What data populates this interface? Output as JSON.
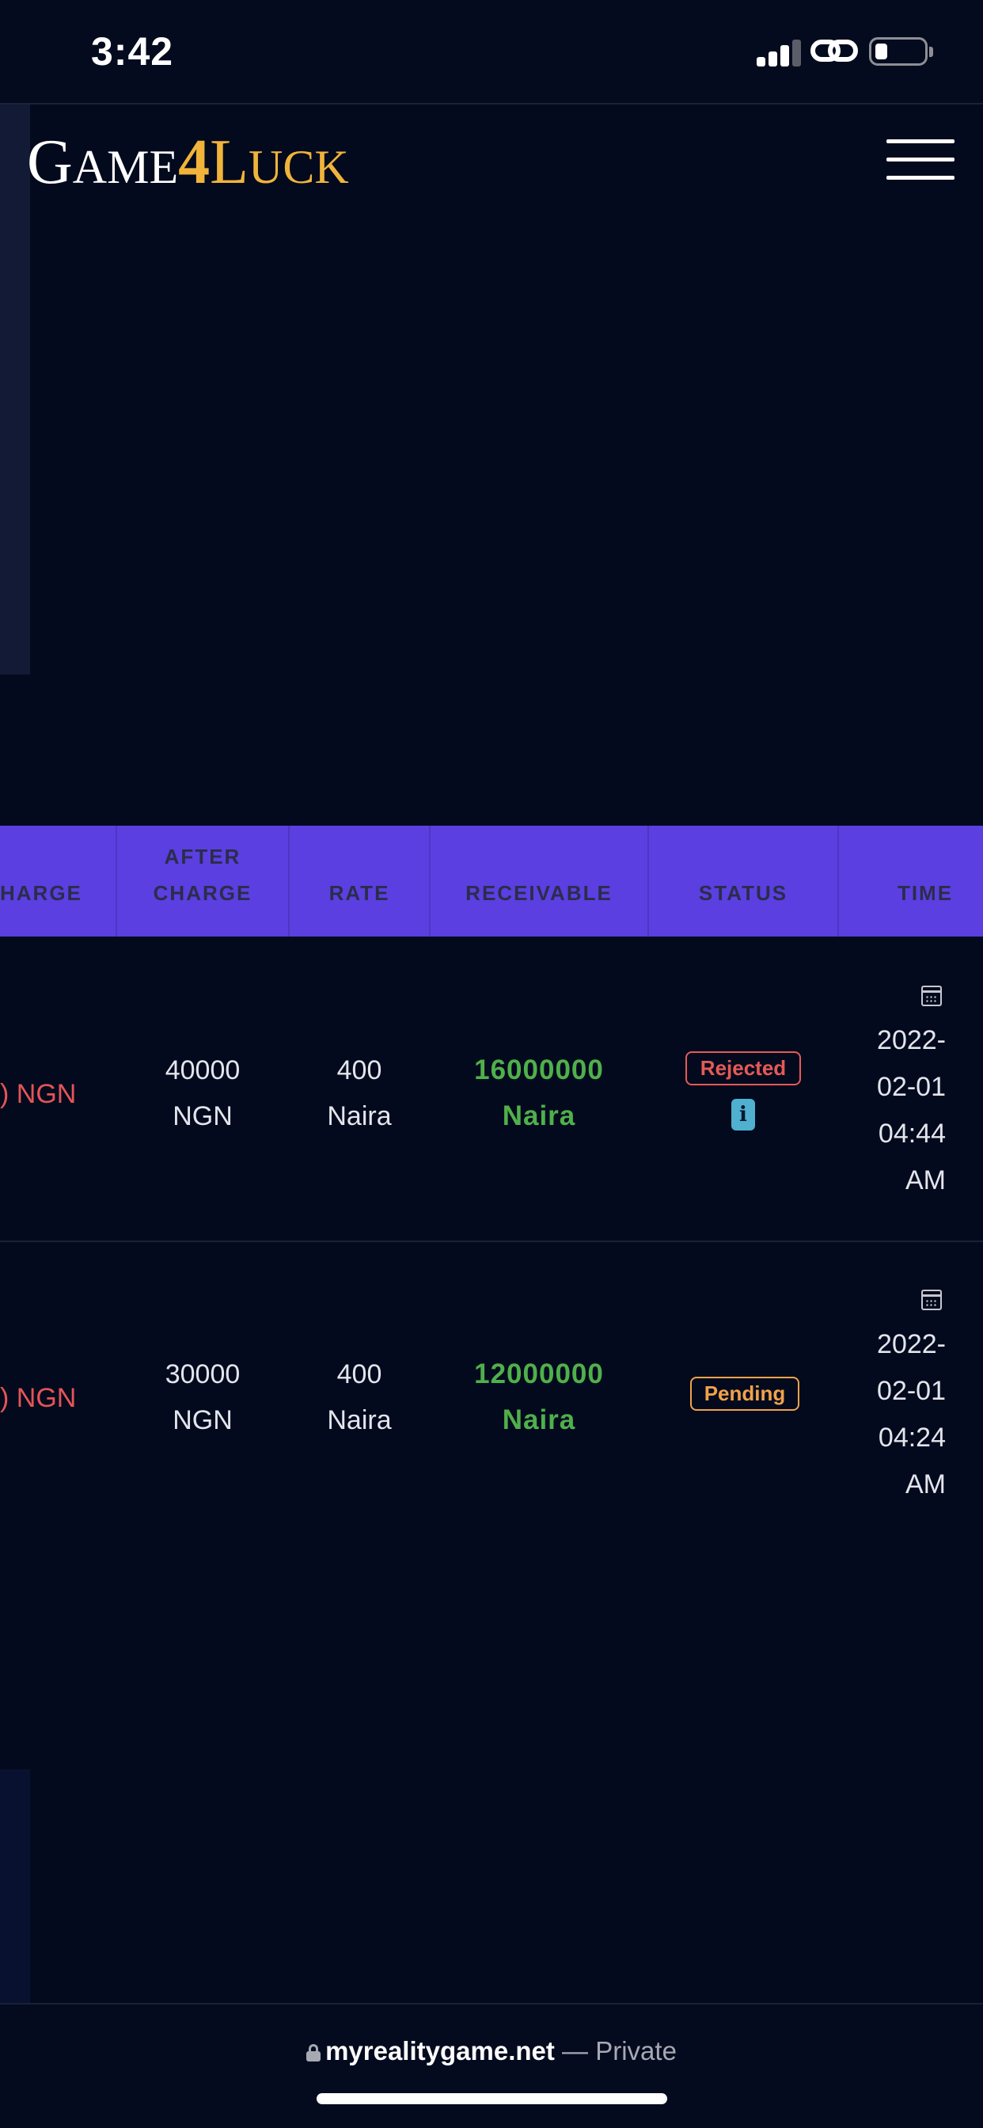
{
  "status_bar": {
    "time": "3:42"
  },
  "header": {
    "logo": {
      "g": "G",
      "ame": "AME",
      "four": "4",
      "l": "L",
      "uck": "UCK"
    }
  },
  "table": {
    "columns": {
      "charge": "HARGE",
      "after_charge_line1": "AFTER",
      "after_charge_line2": "CHARGE",
      "rate": "RATE",
      "receivable": "RECEIVABLE",
      "status": "STATUS",
      "time": "TIME"
    },
    "rows": [
      {
        "charge": ") NGN",
        "after_charge": [
          "40000",
          "NGN"
        ],
        "rate": [
          "400",
          "Naira"
        ],
        "receivable": [
          "16000000",
          "Naira"
        ],
        "status": "Rejected",
        "info": "i",
        "time": [
          "2022-",
          "02-01",
          "04:44",
          "AM"
        ]
      },
      {
        "charge": ") NGN",
        "after_charge": [
          "30000",
          "NGN"
        ],
        "rate": [
          "400",
          "Naira"
        ],
        "receivable": [
          "12000000",
          "Naira"
        ],
        "status": "Pending",
        "time": [
          "2022-",
          "02-01",
          "04:24",
          "AM"
        ]
      }
    ]
  },
  "browser": {
    "domain": "myrealitygame.net",
    "separator": " — ",
    "mode": "Private"
  },
  "colors": {
    "background": "#040a1e",
    "table_header": "#5b3fe0",
    "logo_gold": "#f0b43a",
    "receivable_green": "#4fb04b",
    "charge_red": "#e45555",
    "rejected_red": "#e55a55",
    "pending_orange": "#f0a24a"
  },
  "icons": {
    "signal": "cellular-signal-icon",
    "link": "link-icon",
    "battery": "battery-icon",
    "menu": "hamburger-menu-icon",
    "calendar": "calendar-icon",
    "lock": "lock-icon",
    "info": "info-icon"
  }
}
